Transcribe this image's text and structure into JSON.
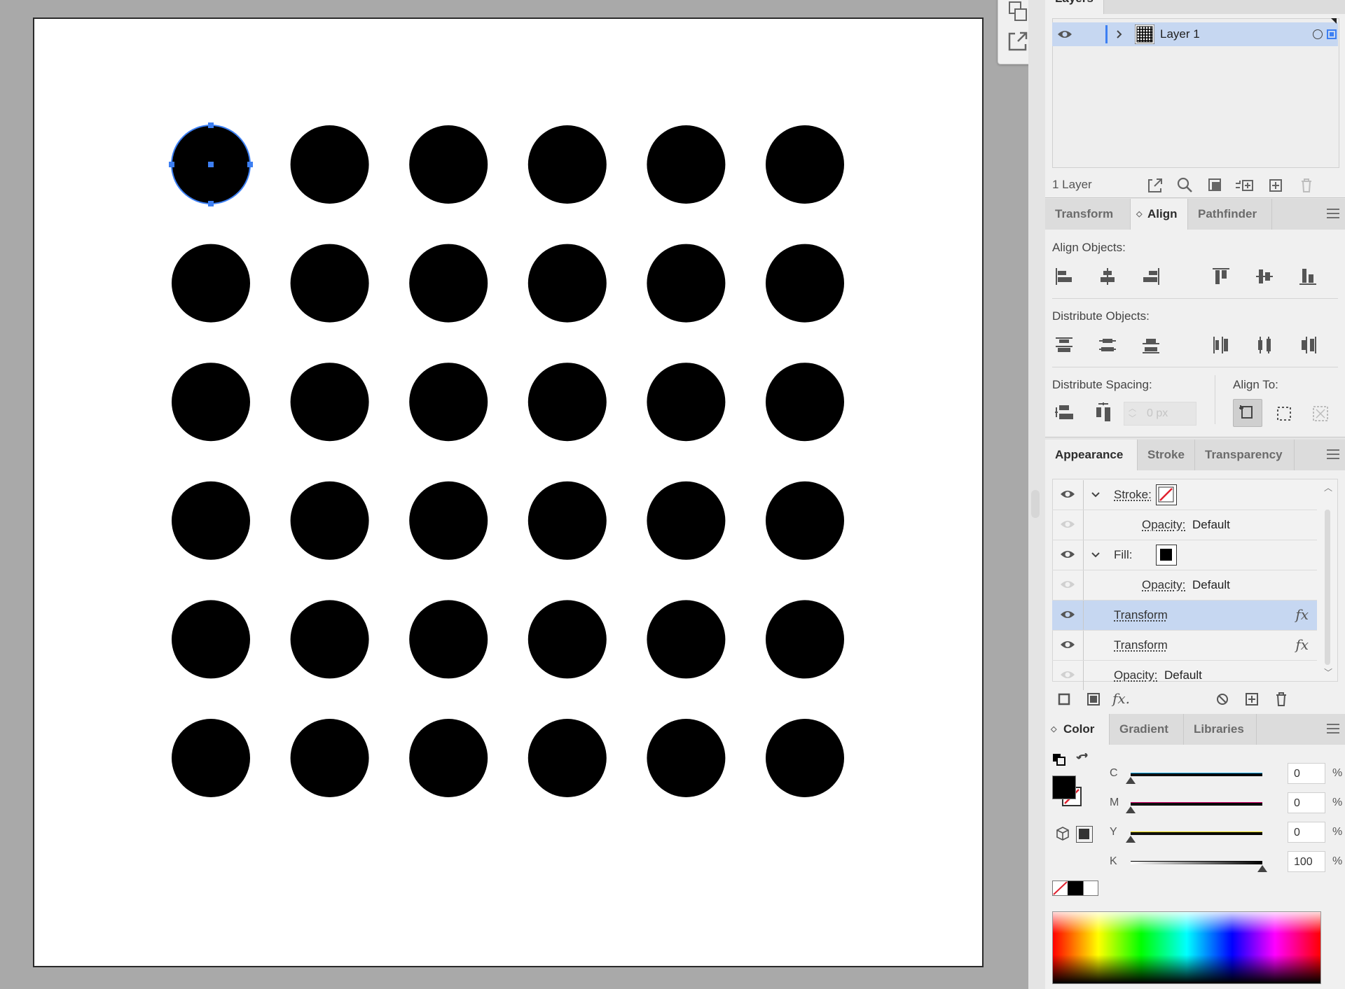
{
  "canvas": {
    "dot_rows": 6,
    "dot_cols": 6,
    "dot_color": "#000000",
    "selection_color": "#3d7ff2",
    "selected_dot": {
      "row": 1,
      "col": 1
    }
  },
  "layers_panel": {
    "title": "Layers",
    "layer_name": "Layer 1",
    "footer_count": "1 Layer"
  },
  "align_panel": {
    "tabs": [
      "Transform",
      "Align",
      "Pathfinder"
    ],
    "active_tab": "Align",
    "align_objects_label": "Align Objects:",
    "distribute_objects_label": "Distribute Objects:",
    "distribute_spacing_label": "Distribute Spacing:",
    "align_to_label": "Align To:",
    "spacing_value": "0 px"
  },
  "appearance_panel": {
    "tabs": [
      "Appearance",
      "Stroke",
      "Transparency"
    ],
    "active_tab": "Appearance",
    "rows": [
      {
        "label": "Stroke:",
        "type": "stroke"
      },
      {
        "label": "Opacity:",
        "value": "Default"
      },
      {
        "label": "Fill:",
        "type": "fill"
      },
      {
        "label": "Opacity:",
        "value": "Default"
      },
      {
        "label": "Transform",
        "fx": "fx"
      },
      {
        "label": "Transform",
        "fx": "fx"
      },
      {
        "label": "Opacity:",
        "value": "Default"
      }
    ],
    "footer_fx": "fx."
  },
  "color_panel": {
    "tabs": [
      "Color",
      "Gradient",
      "Libraries"
    ],
    "active_tab": "Color",
    "channels": [
      {
        "name": "C",
        "value": "0",
        "unit": "%",
        "level": 0,
        "color": "#00a0e0"
      },
      {
        "name": "M",
        "value": "0",
        "unit": "%",
        "level": 0,
        "color": "#d4006b"
      },
      {
        "name": "Y",
        "value": "0",
        "unit": "%",
        "level": 0,
        "color": "#e8d800"
      },
      {
        "name": "K",
        "value": "100",
        "unit": "%",
        "level": 100,
        "color": "#000000"
      }
    ]
  }
}
